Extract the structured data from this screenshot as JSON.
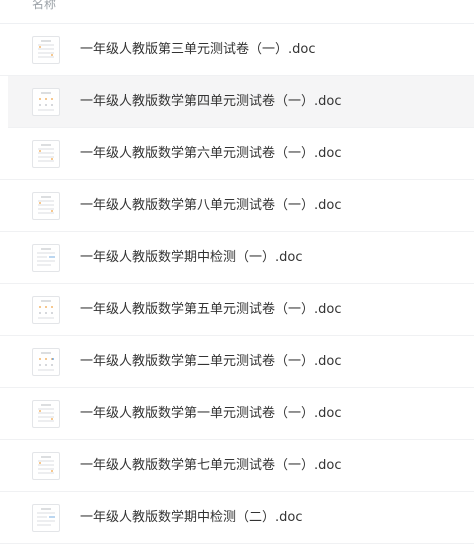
{
  "header": {
    "name_column_label": "名称"
  },
  "files": [
    {
      "name": "一年级人教版第三单元测试卷（一）.doc",
      "thumb_variant": "a",
      "hovered": false
    },
    {
      "name": "一年级人教版数学第四单元测试卷（一）.doc",
      "thumb_variant": "b",
      "hovered": true
    },
    {
      "name": "一年级人教版数学第六单元测试卷（一）.doc",
      "thumb_variant": "c",
      "hovered": false
    },
    {
      "name": "一年级人教版数学第八单元测试卷（一）.doc",
      "thumb_variant": "a",
      "hovered": false
    },
    {
      "name": "一年级人教版数学期中检测（一）.doc",
      "thumb_variant": "d",
      "hovered": false
    },
    {
      "name": "一年级人教版数学第五单元测试卷（一）.doc",
      "thumb_variant": "b",
      "hovered": false
    },
    {
      "name": "一年级人教版数学第二单元测试卷（一）.doc",
      "thumb_variant": "e",
      "hovered": false
    },
    {
      "name": "一年级人教版数学第一单元测试卷（一）.doc",
      "thumb_variant": "c",
      "hovered": false
    },
    {
      "name": "一年级人教版数学第七单元测试卷（一）.doc",
      "thumb_variant": "a",
      "hovered": false
    },
    {
      "name": "一年级人教版数学期中检测（二）.doc",
      "thumb_variant": "d",
      "hovered": false
    }
  ],
  "colors": {
    "row_hover_bg": "#f5f5f6",
    "divider": "#f0f1f3",
    "text": "#333333",
    "header_text": "#9aa0a6",
    "thumb_accent_orange": "#f0a040",
    "thumb_accent_blue": "#4a90d9",
    "thumb_text_gray": "#b8bcc2"
  }
}
